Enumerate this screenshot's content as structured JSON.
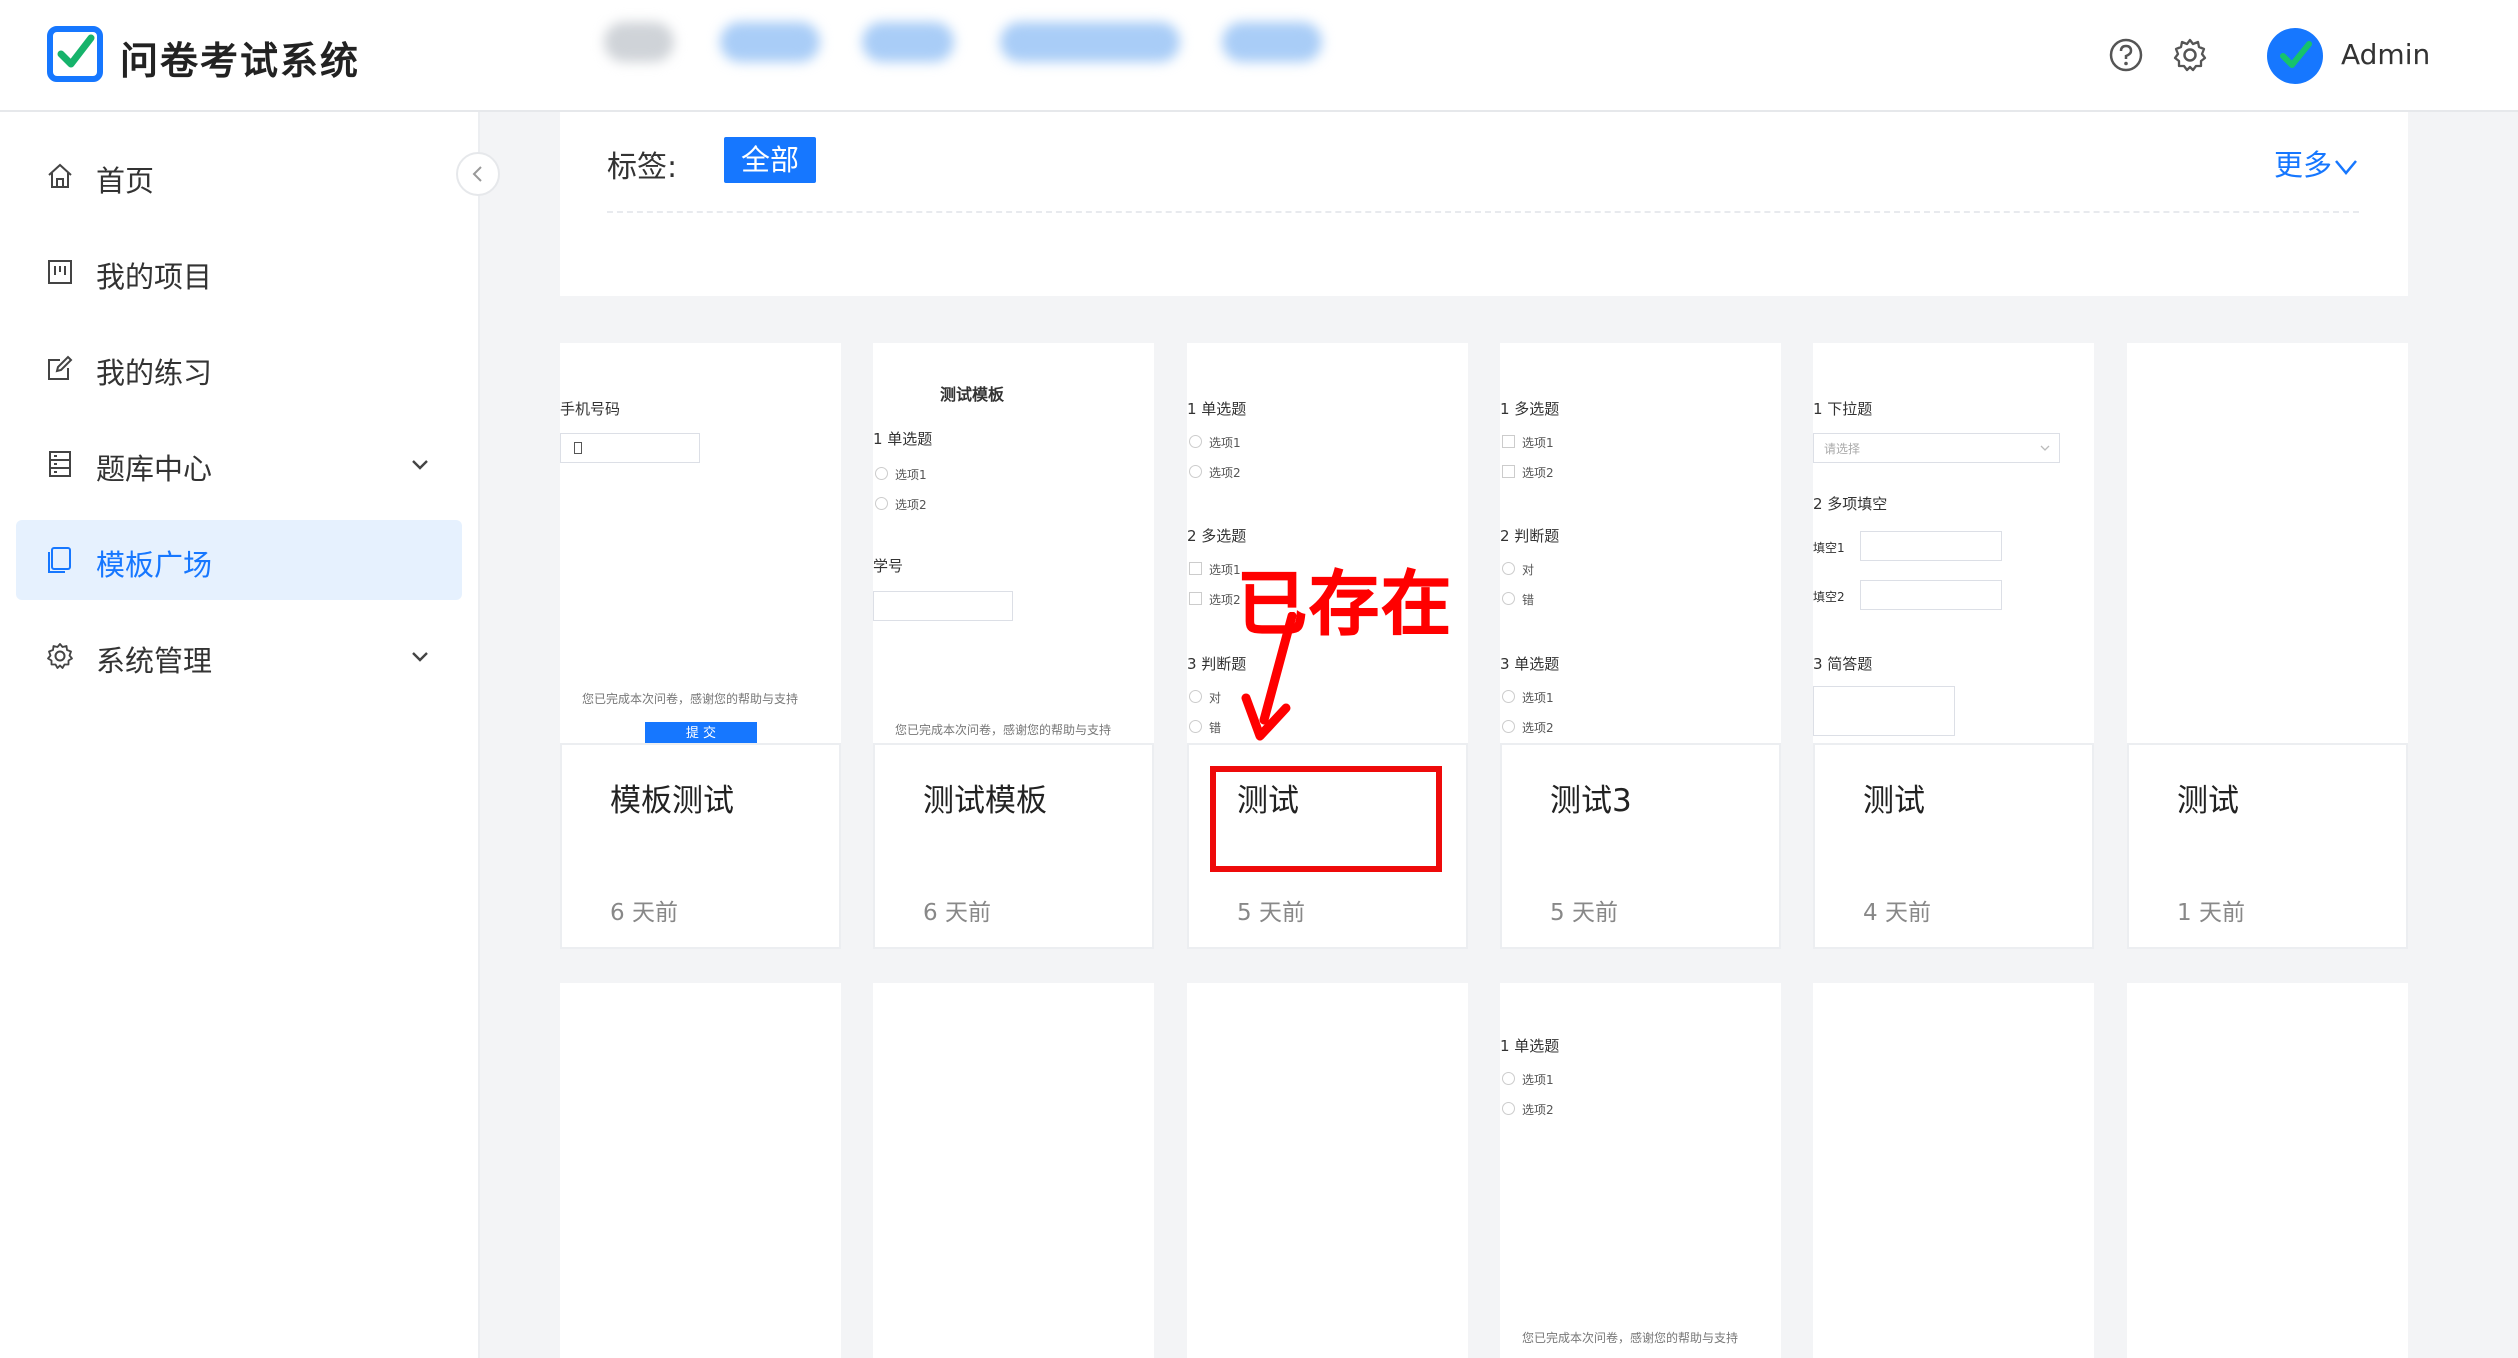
{
  "app": {
    "title": "问卷考试系统",
    "user": "Admin"
  },
  "header_icons": [
    "help-icon",
    "settings-icon"
  ],
  "sidebar": {
    "items": [
      {
        "label": "首页",
        "icon": "home-icon",
        "expandable": false,
        "active": false
      },
      {
        "label": "我的项目",
        "icon": "project-icon",
        "expandable": false,
        "active": false
      },
      {
        "label": "我的练习",
        "icon": "edit-icon",
        "expandable": false,
        "active": false
      },
      {
        "label": "题库中心",
        "icon": "database-icon",
        "expandable": true,
        "active": false
      },
      {
        "label": "模板广场",
        "icon": "template-icon",
        "expandable": false,
        "active": true
      },
      {
        "label": "系统管理",
        "icon": "gear-icon",
        "expandable": true,
        "active": false
      }
    ]
  },
  "filter": {
    "tag_label": "标签:",
    "tag_all": "全部",
    "more": "更多"
  },
  "annotation": {
    "text": "已存在"
  },
  "cards": [
    {
      "title": "模板测试",
      "time": "6 天前",
      "preview": {
        "field_label": "手机号码",
        "footer": "您已完成本次问卷，感谢您的帮助与支持",
        "button": "提 交"
      }
    },
    {
      "title": "测试模板",
      "time": "6 天前",
      "preview": {
        "heading": "测试模板",
        "q1": "1  单选题",
        "opt1": "选项1",
        "opt2": "选项2",
        "field_label": "学号",
        "footer": "您已完成本次问卷，感谢您的帮助与支持"
      }
    },
    {
      "title": "测试",
      "time": "5 天前",
      "preview": {
        "q1": "1  单选题",
        "q1_opt1": "选项1",
        "q1_opt2": "选项2",
        "q2": "2  多选题",
        "q2_opt1": "选项1",
        "q2_opt2": "选项2",
        "q3": "3  判断题",
        "q3_opt1": "对",
        "q3_opt2": "错"
      }
    },
    {
      "title": "测试3",
      "time": "5 天前",
      "preview": {
        "q1": "1  多选题",
        "q1_opt1": "选项1",
        "q1_opt2": "选项2",
        "q2": "2  判断题",
        "q2_opt1": "对",
        "q2_opt2": "错",
        "q3": "3  单选题",
        "q3_opt1": "选项1",
        "q3_opt2": "选项2"
      }
    },
    {
      "title": "测试",
      "time": "4 天前",
      "preview": {
        "q1": "1  下拉题",
        "select_placeholder": "请选择",
        "q2": "2  多项填空",
        "fill1": "填空1",
        "fill2": "填空2",
        "q3": "3  简答题"
      }
    },
    {
      "title": "测试",
      "time": "1 天前",
      "preview": {}
    }
  ],
  "row2_card4_preview": {
    "q1": "1  单选题",
    "opt1": "选项1",
    "opt2": "选项2",
    "footer": "您已完成本次问卷，感谢您的帮助与支持"
  }
}
